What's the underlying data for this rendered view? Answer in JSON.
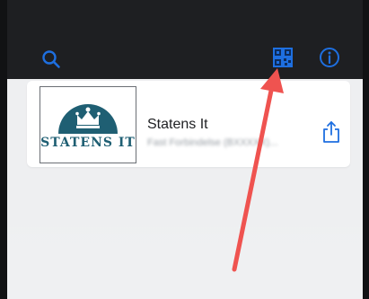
{
  "card": {
    "title": "Statens It",
    "subtitle": "Fast Forbindelse (BXXXXX)...",
    "logo_text": "STATENS IT"
  },
  "icons": {
    "search": "search-icon",
    "qr": "qr-code-icon",
    "info": "info-icon",
    "share": "share-icon",
    "logo": "crown-logo-icon"
  },
  "colors": {
    "accent": "#1e6fe0",
    "logo_teal": "#1f5f73",
    "annotation_arrow": "#ef5350",
    "top_bar": "#1e1f22"
  }
}
